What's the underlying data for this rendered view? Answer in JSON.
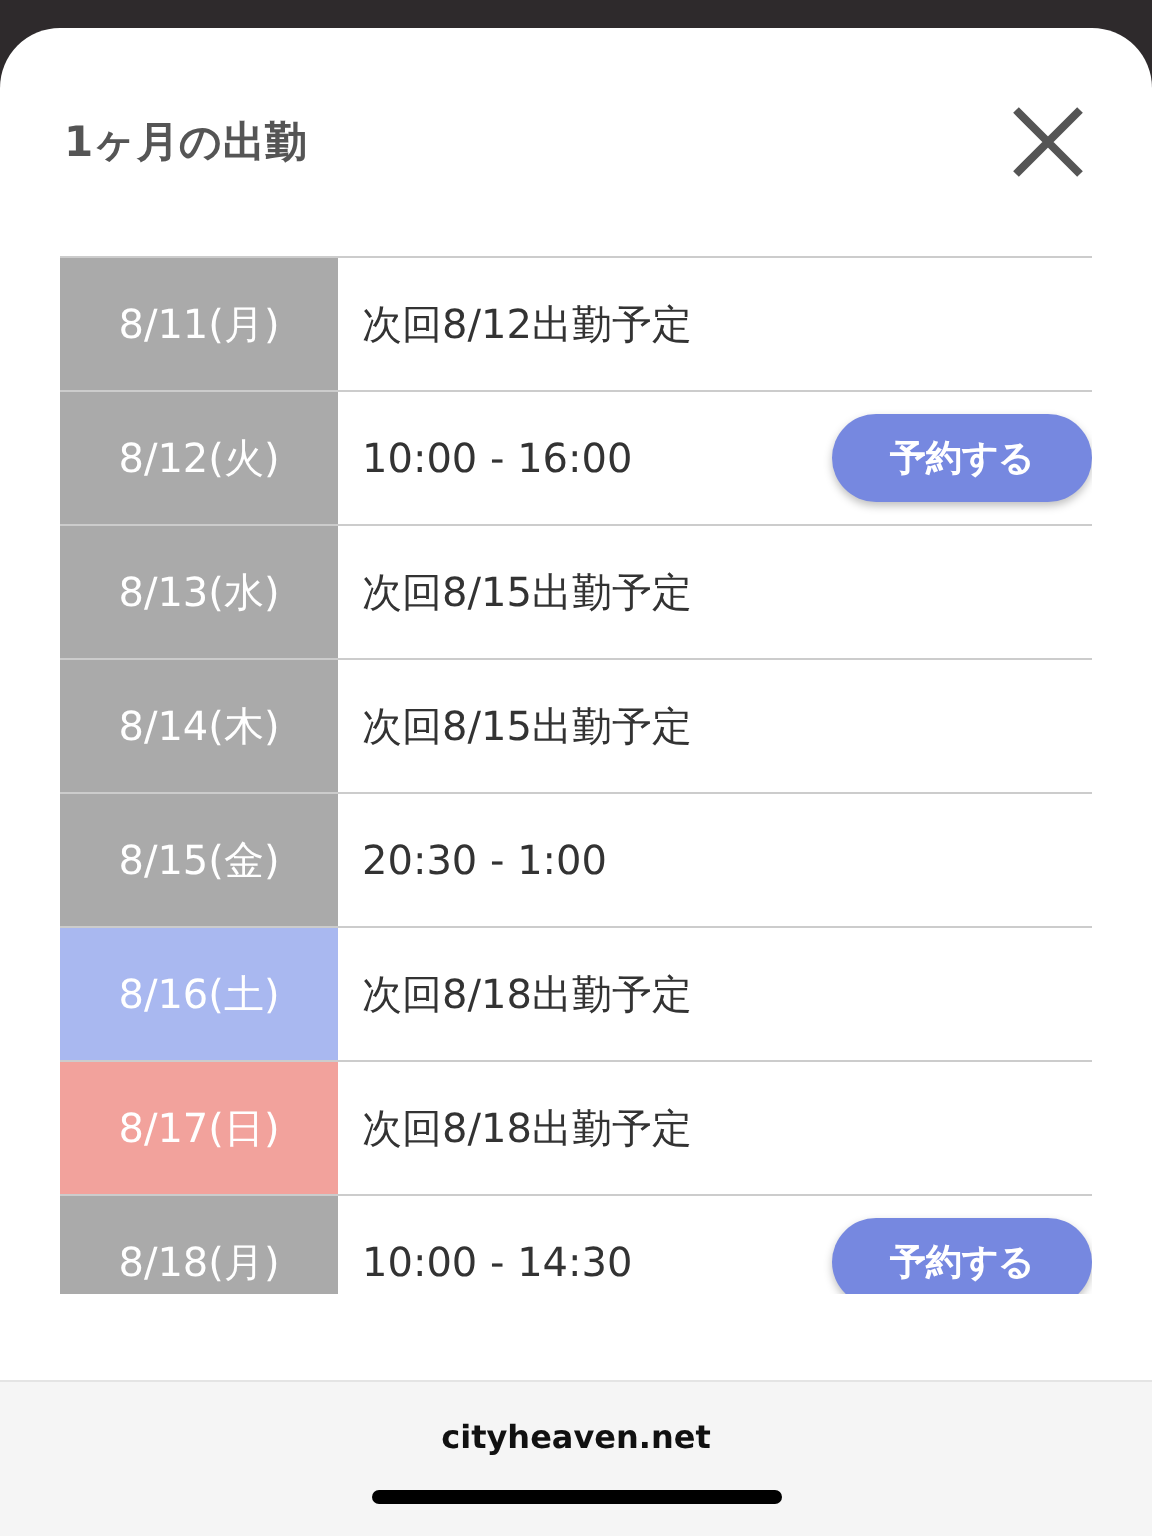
{
  "modal": {
    "title": "1ヶ月の出勤"
  },
  "schedule": [
    {
      "date": "8/11(月)",
      "color": "#aaaaaa",
      "status": "次回8/12出勤予定"
    },
    {
      "date": "8/12(火)",
      "color": "#aaaaaa",
      "status": "10:00 - 16:00",
      "button": "予約する"
    },
    {
      "date": "8/13(水)",
      "color": "#aaaaaa",
      "status": "次回8/15出勤予定"
    },
    {
      "date": "8/14(木)",
      "color": "#aaaaaa",
      "status": "次回8/15出勤予定"
    },
    {
      "date": "8/15(金)",
      "color": "#aaaaaa",
      "status": "20:30 - 1:00"
    },
    {
      "date": "8/16(土)",
      "color": "#a9b8f0",
      "status": "次回8/18出勤予定"
    },
    {
      "date": "8/17(日)",
      "color": "#f2a29c",
      "status": "次回8/18出勤予定"
    },
    {
      "date": "8/18(月)",
      "color": "#aaaaaa",
      "status": "10:00 - 14:30",
      "button": "予約する"
    }
  ],
  "browser_bar": {
    "url": "cityheaven.net"
  }
}
